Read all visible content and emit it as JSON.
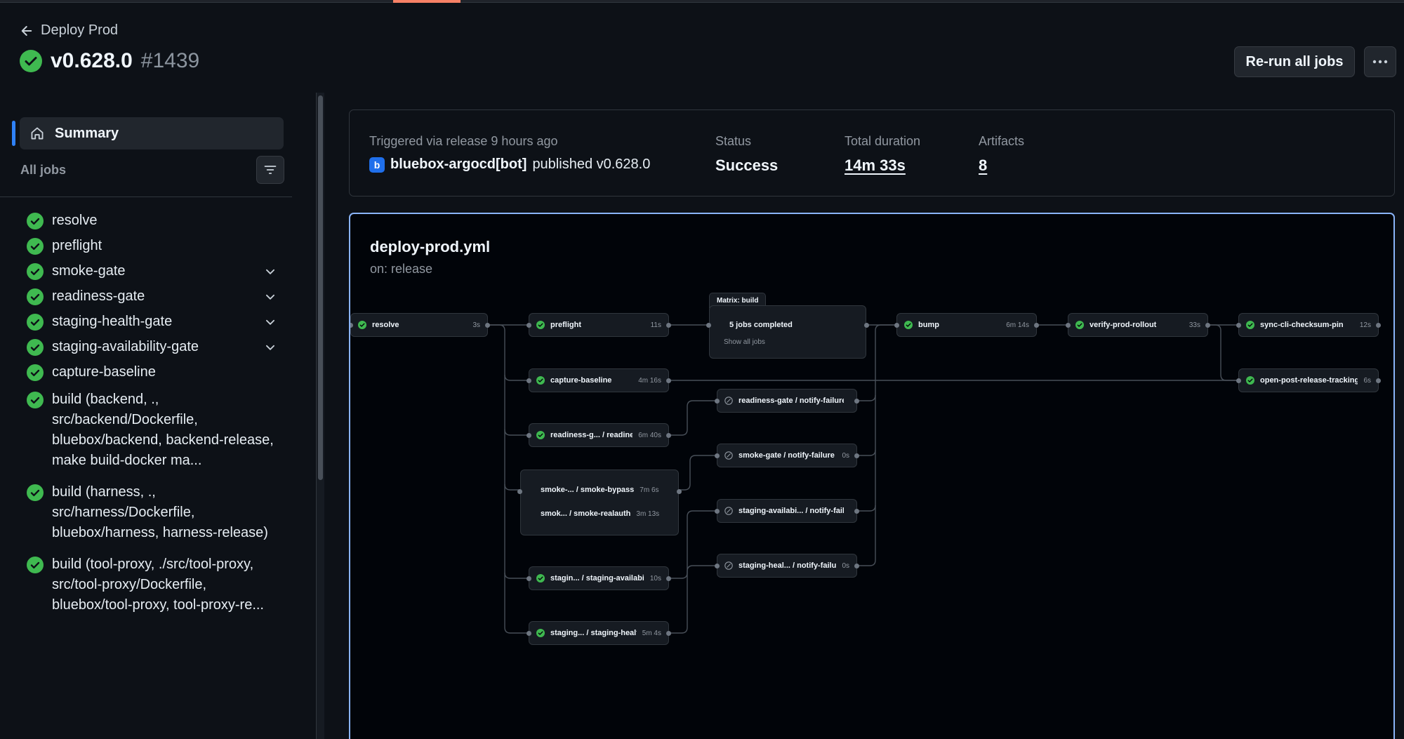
{
  "header": {
    "back_label": "Deploy Prod",
    "version": "v0.628.0",
    "run_number": "#1439",
    "rerun_label": "Re-run all jobs",
    "more_label": "···"
  },
  "sidebar": {
    "summary_label": "Summary",
    "all_jobs_label": "All jobs",
    "jobs": [
      {
        "label": "resolve",
        "expandable": false
      },
      {
        "label": "preflight",
        "expandable": false
      },
      {
        "label": "smoke-gate",
        "expandable": true
      },
      {
        "label": "readiness-gate",
        "expandable": true
      },
      {
        "label": "staging-health-gate",
        "expandable": true
      },
      {
        "label": "staging-availability-gate",
        "expandable": true
      },
      {
        "label": "capture-baseline",
        "expandable": false
      },
      {
        "label": "build (backend, ., src/backend/Dockerfile, bluebox/backend, backend-release, make build-docker ma...",
        "expandable": false
      },
      {
        "label": "build (harness, ., src/harness/Dockerfile, bluebox/harness, harness-release)",
        "expandable": false
      },
      {
        "label": "build (tool-proxy, ./src/tool-proxy, src/tool-proxy/Dockerfile, bluebox/tool-proxy, tool-proxy-re...",
        "expandable": false
      }
    ]
  },
  "summary_card": {
    "trigger_label": "Triggered via release 9 hours ago",
    "actor": "bluebox-argocd[bot]",
    "actor_avatar": "b",
    "action_text": "published v0.628.0",
    "status_label": "Status",
    "status_value": "Success",
    "duration_label": "Total duration",
    "duration_value": "14m 33s",
    "artifacts_label": "Artifacts",
    "artifacts_value": "8"
  },
  "workflow": {
    "file": "deploy-prod.yml",
    "trigger": "on: release",
    "nodes": {
      "resolve": {
        "name": "resolve",
        "duration": "3s",
        "state": "success"
      },
      "preflight": {
        "name": "preflight",
        "duration": "11s",
        "state": "success"
      },
      "capture_baseline": {
        "name": "capture-baseline",
        "duration": "4m 16s",
        "state": "success"
      },
      "readiness": {
        "name": "readiness-g... / readiness",
        "duration": "6m 40s",
        "state": "success"
      },
      "smoke_bypass": {
        "name": "smoke-... / smoke-bypass",
        "duration": "7m 6s",
        "state": "success"
      },
      "smoke_realauth": {
        "name": "smok... / smoke-realauth",
        "duration": "3m 13s",
        "state": "success"
      },
      "staging_availability": {
        "name": "stagin... / staging-availability",
        "duration": "10s",
        "state": "success"
      },
      "staging_health": {
        "name": "staging... / staging-health",
        "duration": "5m 4s",
        "state": "success"
      },
      "readiness_notify": {
        "name": "readiness-gate / notify-failure",
        "duration": "",
        "state": "skipped"
      },
      "smoke_notify": {
        "name": "smoke-gate / notify-failure",
        "duration": "0s",
        "state": "skipped"
      },
      "staging_avail_notify": {
        "name": "staging-availabi... / notify-failure",
        "duration": "",
        "state": "skipped"
      },
      "staging_heal_notify": {
        "name": "staging-heal... / notify-failure",
        "duration": "0s",
        "state": "skipped"
      },
      "bump": {
        "name": "bump",
        "duration": "6m 14s",
        "state": "success"
      },
      "verify": {
        "name": "verify-prod-rollout",
        "duration": "33s",
        "state": "success"
      },
      "sync": {
        "name": "sync-cli-checksum-pin",
        "duration": "12s",
        "state": "success"
      },
      "open_tracking": {
        "name": "open-post-release-tracking",
        "duration": "6s",
        "state": "success"
      }
    },
    "matrix": {
      "label": "Matrix: build",
      "summary": "5 jobs completed",
      "show_all": "Show all jobs"
    }
  },
  "colors": {
    "success": "#3fb950",
    "accent": "#2f81f7",
    "tab_active": "#f78166"
  }
}
